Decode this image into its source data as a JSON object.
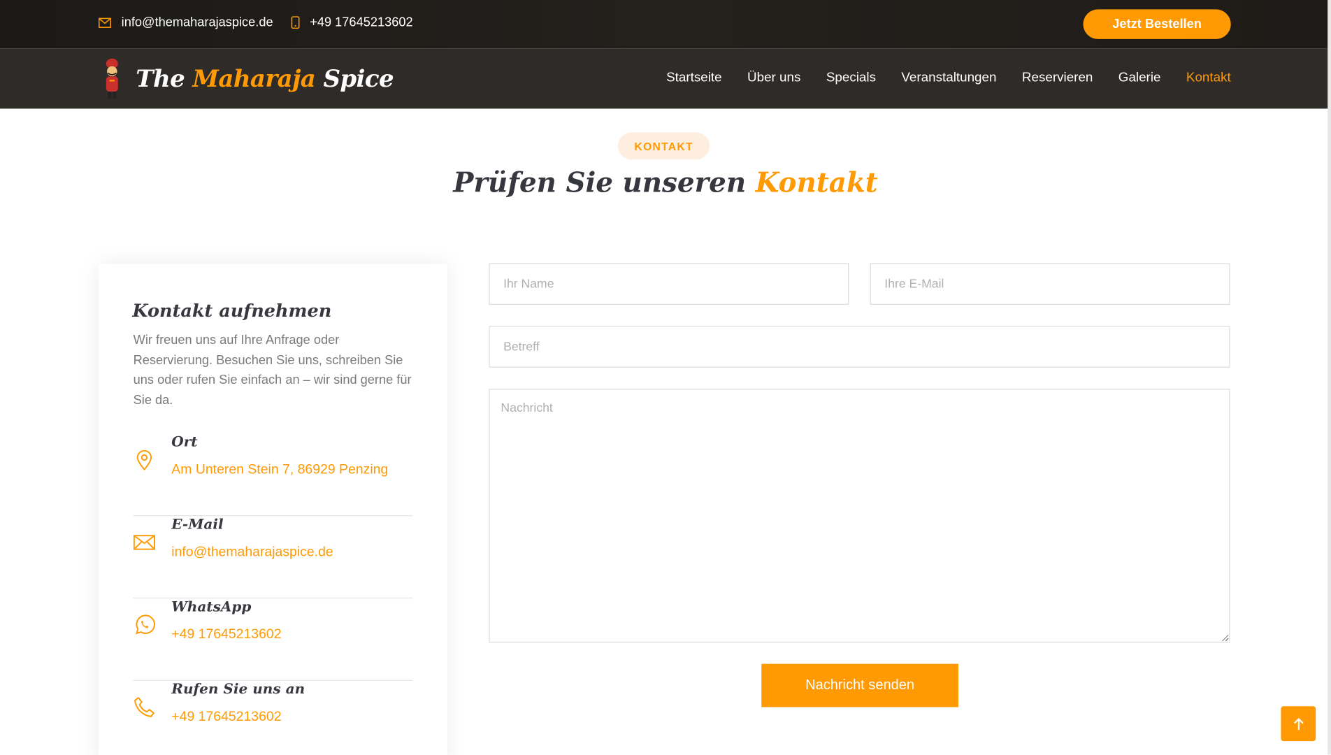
{
  "topbar": {
    "email": "info@themaharajaspice.de",
    "phone": "+49 17645213602",
    "order_label": "Jetzt Bestellen"
  },
  "brand": {
    "name_part1": "The",
    "name_part2": "Maharaja",
    "name_part3": "Spice"
  },
  "nav": {
    "items": [
      {
        "label": "Startseite"
      },
      {
        "label": "Über uns"
      },
      {
        "label": "Specials"
      },
      {
        "label": "Veranstaltungen"
      },
      {
        "label": "Reservieren"
      },
      {
        "label": "Galerie"
      },
      {
        "label": "Kontakt",
        "active": true
      }
    ]
  },
  "section": {
    "badge": "KONTAKT",
    "heading_main": "Prüfen Sie unseren",
    "heading_accent": "Kontakt"
  },
  "info": {
    "title": "Kontakt aufnehmen",
    "description": "Wir freuen uns auf Ihre Anfrage oder Reservierung. Besuchen Sie uns, schreiben Sie uns oder rufen Sie einfach an – wir sind gerne für Sie da.",
    "items": [
      {
        "icon": "map-pin-icon",
        "title": "Ort",
        "value": "Am Unteren Stein 7, 86929 Penzing"
      },
      {
        "icon": "envelope-icon",
        "title": "E-Mail",
        "value": "info@themaharajaspice.de"
      },
      {
        "icon": "whatsapp-icon",
        "title": "WhatsApp",
        "value": "+49 17645213602"
      },
      {
        "icon": "phone-icon",
        "title": "Rufen Sie uns an",
        "value": "+49 17645213602"
      }
    ]
  },
  "form": {
    "name_placeholder": "Ihr Name",
    "email_placeholder": "Ihre E-Mail",
    "subject_placeholder": "Betreff",
    "message_placeholder": "Nachricht",
    "submit_label": "Nachricht senden"
  },
  "colors": {
    "accent": "#ff9a05",
    "dark": "#2e2b29",
    "text": "#37373f"
  }
}
